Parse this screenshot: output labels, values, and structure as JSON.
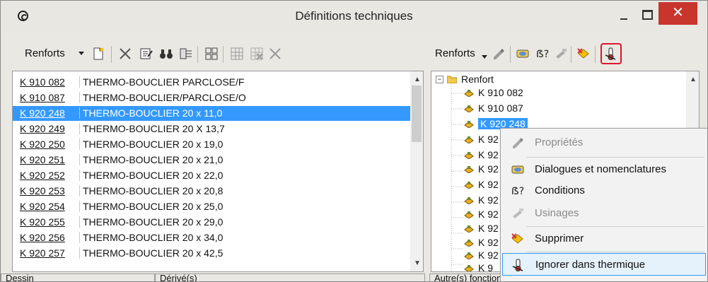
{
  "window": {
    "title": "Définitions techniques",
    "close_glyph": "✕"
  },
  "left_toolbar": {
    "label": "Renforts",
    "icons": [
      "new-document-icon",
      "delete-x-icon",
      "properties-icon",
      "find-binoculars-icon",
      "layout-icon",
      "multi-select-icon",
      "grid-icon",
      "multi-delete-icon",
      "delete-x-icon-2"
    ]
  },
  "right_toolbar": {
    "label": "Renforts",
    "icons": [
      "properties-icon",
      "dialogs-icon",
      "conditions-icon",
      "machining-icon",
      "delete-icon",
      "thermal-ignore-icon"
    ]
  },
  "list": {
    "rows": [
      {
        "code": "K 910 082",
        "desc": "THERMO-BOUCLIER PARCLOSE/F"
      },
      {
        "code": "K 910 087",
        "desc": "THERMO-BOUCLIER/PARCLOSE/O"
      },
      {
        "code": "K 920 248",
        "desc": "THERMO-BOUCLIER  20 x 11,0"
      },
      {
        "code": "K 920 249",
        "desc": "THERMO-BOUCLIER 20 X 13,7"
      },
      {
        "code": "K 920 250",
        "desc": "THERMO-BOUCLIER  20 x 19,0"
      },
      {
        "code": "K 920 251",
        "desc": "THERMO-BOUCLIER  20 x 21,0"
      },
      {
        "code": "K 920 252",
        "desc": "THERMO-BOUCLIER  20 x 22,0"
      },
      {
        "code": "K 920 253",
        "desc": "THERMO-BOUCLIER 20 x 20,8"
      },
      {
        "code": "K 920 254",
        "desc": "THERMO-BOUCLIER  20 x 25,0"
      },
      {
        "code": "K 920 255",
        "desc": "THERMO-BOUCLIER  20 x 29,0"
      },
      {
        "code": "K 920 256",
        "desc": "THERMO-BOUCLIER  20 x 34,0"
      },
      {
        "code": "K 920 257",
        "desc": "THERMO-BOUCLIER  20 x 42,5"
      }
    ]
  },
  "tree": {
    "root": "Renfort",
    "root_expander": "−",
    "children": [
      "K 910 082",
      "K 910 087",
      "K 920 248",
      "K 92",
      "K 92",
      "K 92",
      "K 92",
      "K 92",
      "K 92",
      "K 92",
      "K 92",
      "K 92",
      "K 9"
    ]
  },
  "context_menu": {
    "items": [
      {
        "label": "Propriétés",
        "enabled": false
      },
      {
        "label": "Dialogues et nomenclatures",
        "enabled": true
      },
      {
        "label": "Conditions",
        "enabled": true
      },
      {
        "label": "Usinages",
        "enabled": false
      },
      {
        "label": "Supprimer",
        "enabled": true
      },
      {
        "label": "Ignorer dans thermique",
        "enabled": true
      }
    ]
  },
  "status": {
    "cells": [
      "Dessin",
      "Dérivé(s)",
      "Autre(s) fonction"
    ]
  },
  "colors": {
    "selection": "#3399ff",
    "close": "#c8352d",
    "highlight_box": "#e0142b"
  }
}
